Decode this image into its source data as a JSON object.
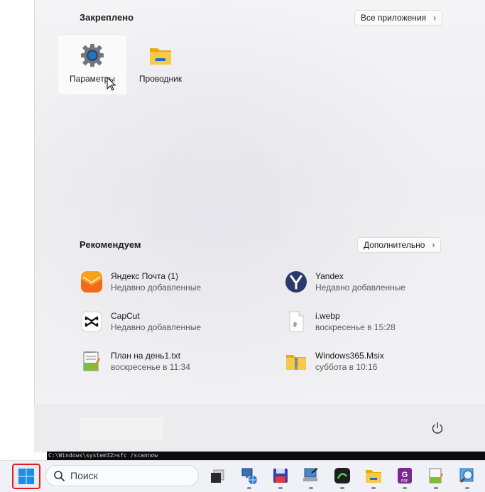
{
  "start_menu": {
    "pinned": {
      "title": "Закреплено",
      "all_apps_label": "Все приложения",
      "items": [
        {
          "label": "Параметры",
          "icon": "settings-gear-icon"
        },
        {
          "label": "Проводник",
          "icon": "file-explorer-folder-icon"
        }
      ]
    },
    "recommended": {
      "title": "Рекомендуем",
      "more_label": "Дополнительно",
      "items": [
        {
          "title": "Яндекс Почта (1)",
          "subtitle": "Недавно добавленные",
          "icon": "yandex-mail-icon"
        },
        {
          "title": "Yandex",
          "subtitle": "Недавно добавленные",
          "icon": "yandex-browser-icon"
        },
        {
          "title": "CapCut",
          "subtitle": "Недавно добавленные",
          "icon": "capcut-icon"
        },
        {
          "title": "i.webp",
          "subtitle": "воскресенье в 15:28",
          "icon": "webp-file-icon"
        },
        {
          "title": "План на день1.txt",
          "subtitle": "воскресенье в 11:34",
          "icon": "notepad-file-icon"
        },
        {
          "title": "Windows365.Msix",
          "subtitle": "суббота в 10:16",
          "icon": "zip-folder-icon"
        }
      ]
    }
  },
  "console_text": "C:\\Windows\\system32>sfc /scannow",
  "taskbar": {
    "search_placeholder": "Поиск",
    "icons": [
      "task-view-icon",
      "network-computer-icon",
      "floppy-save-icon",
      "remote-pc-icon",
      "terminal-app-icon",
      "file-explorer-icon",
      "pdf-app-icon",
      "notepad-icon",
      "image-search-icon"
    ]
  },
  "colors": {
    "accent": "#0067c0",
    "start_highlight": "#e02020",
    "folder": "#f5c518"
  }
}
